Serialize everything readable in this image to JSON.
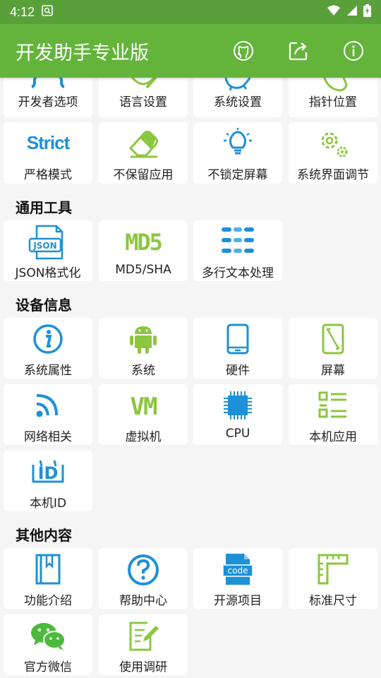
{
  "status": {
    "time": "4:12"
  },
  "appbar": {
    "title": "开发助手专业版"
  },
  "top_items": [
    "开发者选项",
    "语言设置",
    "系统设置",
    "指针位置"
  ],
  "row2_items": [
    "严格模式",
    "不保留应用",
    "不锁定屏幕",
    "系统界面调节"
  ],
  "strict_text": "Strict",
  "sections": {
    "tools": "通用工具",
    "device": "设备信息",
    "other": "其他内容"
  },
  "tools_items": [
    "JSON格式化",
    "MD5/SHA",
    "多行文本处理"
  ],
  "json_icon_text": "JSON",
  "md5_icon_text": "MD5",
  "device_items": [
    "系统属性",
    "系统",
    "硬件",
    "屏幕",
    "网络相关",
    "虚拟机",
    "CPU",
    "本机应用",
    "本机ID"
  ],
  "vm_icon_text": "VM",
  "id_icon_text": "ID",
  "other_items": [
    "功能介绍",
    "帮助中心",
    "开源项目",
    "标准尺寸",
    "官方微信",
    "使用调研"
  ],
  "code_icon_text": "code",
  "colors": {
    "appbar": "#64b43c",
    "statusbar": "#5aa03a",
    "icon_blue": "#1e90d6",
    "icon_green": "#8cc63e"
  }
}
